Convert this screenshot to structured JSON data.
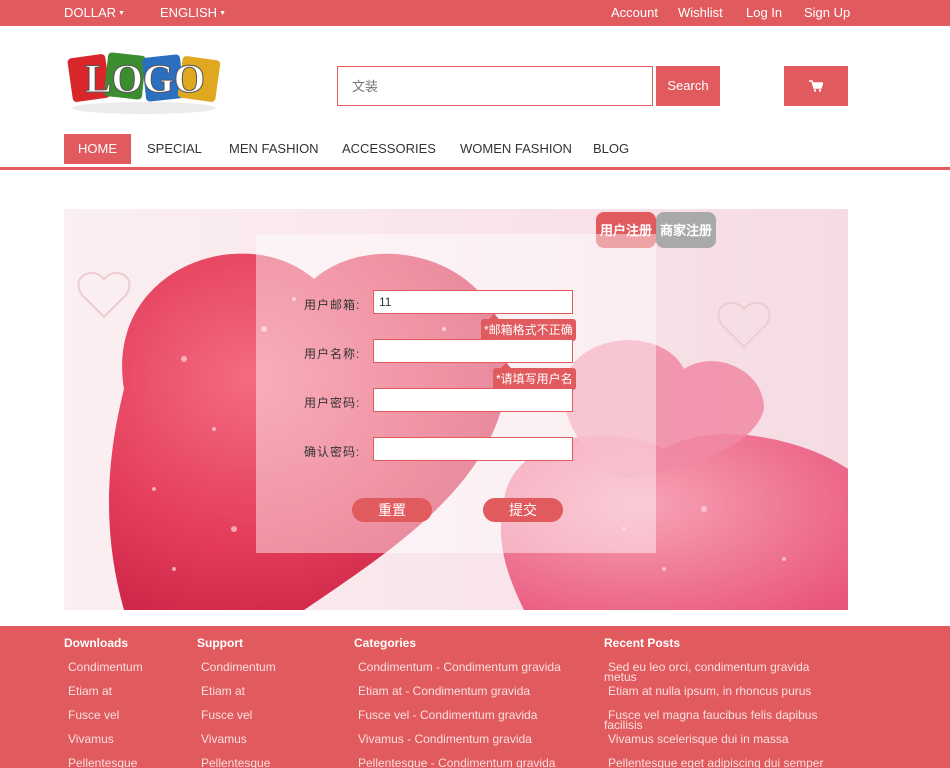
{
  "topbar": {
    "currency": "DOLLAR",
    "language": "ENGLISH",
    "account": "Account",
    "wishlist": "Wishlist",
    "login": "Log In",
    "signup": "Sign Up"
  },
  "header": {
    "logo_text": "LOGO",
    "search_placeholder": "文装",
    "search_button": "Search",
    "cart_icon": "cart-icon"
  },
  "nav": {
    "items": [
      "HOME",
      "SPECIAL",
      "MEN FASHION",
      "ACCESSORIES",
      "WOMEN FASHION",
      "BLOG"
    ],
    "active": "HOME"
  },
  "register": {
    "tabs": {
      "user": "用户注册",
      "merchant": "商家注册"
    },
    "active_tab": "用户注册",
    "fields": {
      "email": {
        "label": "用户邮箱:",
        "value": "11",
        "error": "*邮箱格式不正确"
      },
      "username": {
        "label": "用户名称:",
        "value": "",
        "error": "*请填写用户名"
      },
      "password": {
        "label": "用户密码:",
        "value": ""
      },
      "confirm": {
        "label": "确认密码:",
        "value": ""
      }
    },
    "reset_button": "重置",
    "submit_button": "提交"
  },
  "footer": {
    "downloads": {
      "title": "Downloads",
      "links": [
        "Condimentum",
        "Etiam at",
        "Fusce vel",
        "Vivamus",
        "Pellentesque"
      ]
    },
    "support": {
      "title": "Support",
      "links": [
        "Condimentum",
        "Etiam at",
        "Fusce vel",
        "Vivamus",
        "Pellentesque"
      ]
    },
    "categories": {
      "title": "Categories",
      "links": [
        "Condimentum - Condimentum gravida",
        "Etiam at - Condimentum gravida",
        "Fusce vel - Condimentum gravida",
        "Vivamus - Condimentum gravida",
        "Pellentesque - Condimentum gravida"
      ]
    },
    "recent_posts": {
      "title": "Recent Posts",
      "posts": [
        {
          "line1": "Sed eu leo orci, condimentum gravida",
          "line2": "metus"
        },
        {
          "line1": "Etiam at nulla ipsum, in rhoncus purus",
          "line2": ""
        },
        {
          "line1": "Fusce vel magna faucibus felis dapibus",
          "line2": "facilisis"
        },
        {
          "line1": "Vivamus scelerisque dui in massa",
          "line2": ""
        },
        {
          "line1": "Pellentesque eget adipiscing dui semper",
          "line2": ""
        }
      ]
    }
  },
  "colors": {
    "accent": "#e05a5e",
    "merchant_tab": "#a9a9a9"
  }
}
